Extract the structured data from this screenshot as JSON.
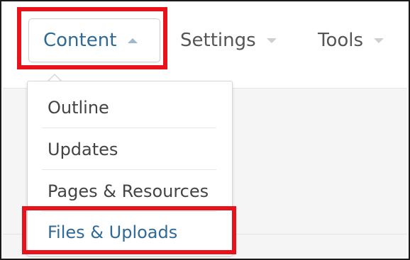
{
  "nav": {
    "content_label": "Content",
    "settings_label": "Settings",
    "tools_label": "Tools"
  },
  "dropdown": {
    "items": [
      {
        "label": "Outline"
      },
      {
        "label": "Updates"
      },
      {
        "label": "Pages & Resources"
      },
      {
        "label": "Files & Uploads"
      }
    ]
  },
  "colors": {
    "active_link": "#2f6a96",
    "highlight_border": "#e8131a",
    "text": "#555555"
  },
  "icons": {
    "caret_up": "caret-up-icon",
    "caret_down": "caret-down-icon"
  }
}
